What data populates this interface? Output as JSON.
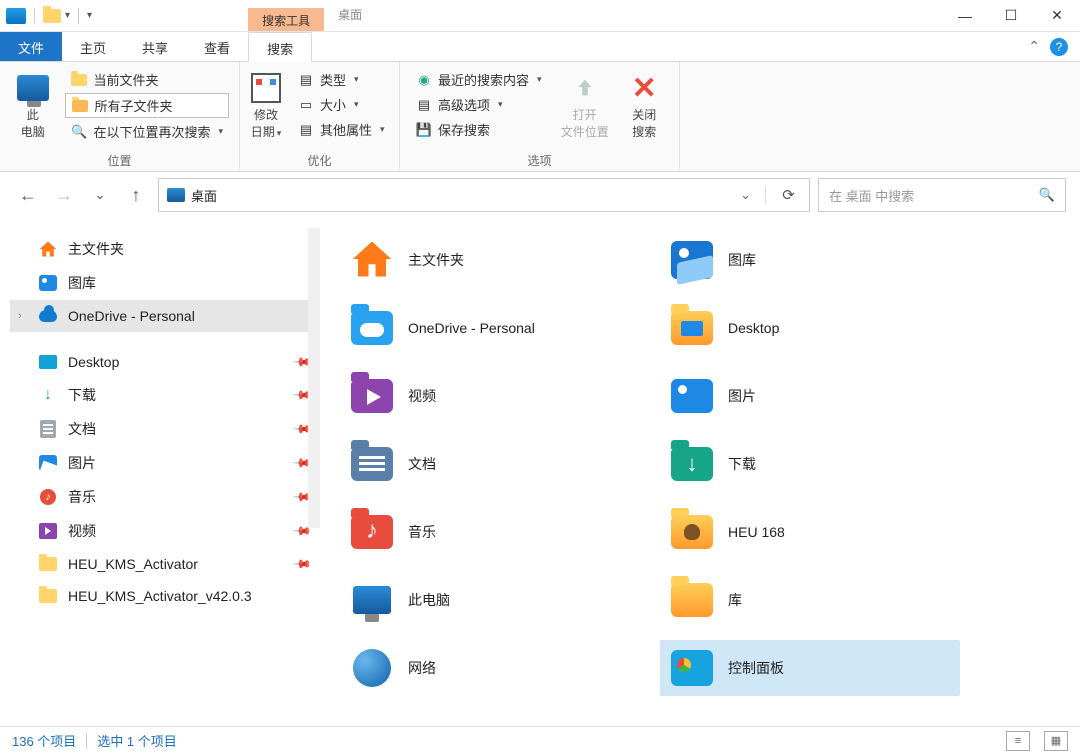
{
  "titlebar": {
    "context_tab": "搜索工具",
    "window_title": "桌面"
  },
  "tabs": {
    "file": "文件",
    "home": "主页",
    "share": "共享",
    "view": "查看",
    "search": "搜索"
  },
  "ribbon": {
    "location": {
      "this_pc": "此\n电脑",
      "current_folder": "当前文件夹",
      "all_subfolders": "所有子文件夹",
      "search_again": "在以下位置再次搜索",
      "group_label": "位置"
    },
    "refine": {
      "date_modified": "修改\n日期",
      "kind": "类型",
      "size": "大小",
      "other_props": "其他属性",
      "group_label": "优化"
    },
    "options": {
      "recent": "最近的搜索内容",
      "advanced": "高级选项",
      "save": "保存搜索",
      "open_location": "打开\n文件位置",
      "close_search": "关闭\n搜索",
      "group_label": "选项"
    }
  },
  "nav": {
    "address": "桌面",
    "search_placeholder": "在 桌面 中搜索"
  },
  "sidebar": {
    "home": "主文件夹",
    "gallery": "图库",
    "onedrive": "OneDrive - Personal",
    "desktop": "Desktop",
    "downloads": "下载",
    "documents": "文档",
    "pictures": "图片",
    "music": "音乐",
    "videos": "视频",
    "heu1": "HEU_KMS_Activator",
    "heu2": "HEU_KMS_Activator_v42.0.3"
  },
  "items": [
    {
      "label": "主文件夹",
      "icon": "home"
    },
    {
      "label": "图库",
      "icon": "gallery"
    },
    {
      "label": "OneDrive - Personal",
      "icon": "onedrive"
    },
    {
      "label": "Desktop",
      "icon": "desktop"
    },
    {
      "label": "视频",
      "icon": "video"
    },
    {
      "label": "图片",
      "icon": "pic"
    },
    {
      "label": "文档",
      "icon": "doc"
    },
    {
      "label": "下载",
      "icon": "down"
    },
    {
      "label": "音乐",
      "icon": "music"
    },
    {
      "label": "HEU 168",
      "icon": "heu"
    },
    {
      "label": "此电脑",
      "icon": "pc"
    },
    {
      "label": "库",
      "icon": "lib"
    },
    {
      "label": "网络",
      "icon": "net"
    },
    {
      "label": "控制面板",
      "icon": "cp",
      "selected": true
    }
  ],
  "status": {
    "count": "136 个项目",
    "selected": "选中 1 个项目"
  }
}
